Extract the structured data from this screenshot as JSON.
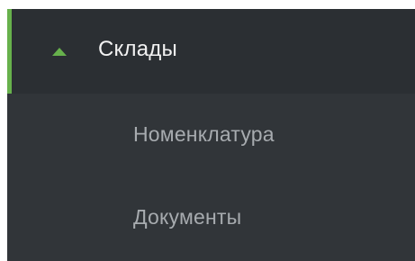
{
  "sidebar": {
    "accent_color": "#67b14c",
    "section": {
      "label": "Склады",
      "icon": "caret-up-icon",
      "expanded": true,
      "active": true
    },
    "items": [
      {
        "label": "Номенклатура"
      },
      {
        "label": "Документы"
      }
    ]
  }
}
